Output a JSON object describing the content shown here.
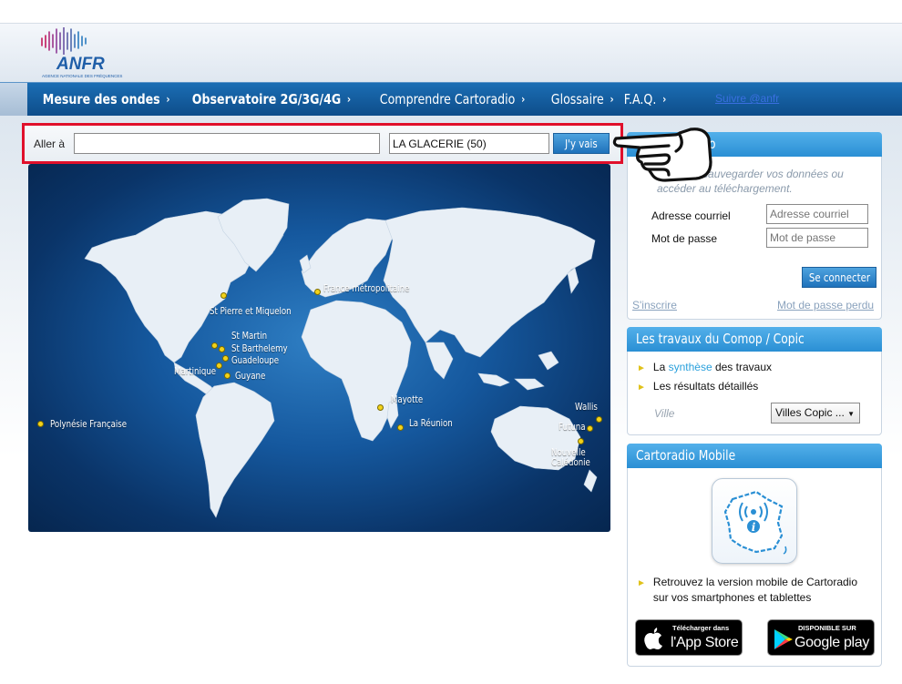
{
  "brand": {
    "logo_text": "ANFR",
    "logo_subtitle": "AGENCE NATIONALE DES FRÉQUENCES",
    "bar_colors": [
      "#c2185b",
      "#8e3c97",
      "#5b5ea6",
      "#2a7bbf"
    ]
  },
  "nav": {
    "items": [
      {
        "label": "Mesure des ondes",
        "bold": true
      },
      {
        "label": "Observatoire 2G/3G/4G",
        "bold": true
      },
      {
        "label": "Comprendre Cartoradio",
        "bold": false
      },
      {
        "label": "Glossaire",
        "bold": false
      },
      {
        "label": "F.A.Q.",
        "bold": false
      }
    ],
    "chevron": "›",
    "follow_link": "Suivre @anfr"
  },
  "search": {
    "label": "Aller à",
    "address_value": "",
    "commune_value": "LA GLACERIE (50)",
    "go_label": "J'y vais"
  },
  "map": {
    "labels": [
      {
        "text": "France métropolitaine"
      },
      {
        "text": "St Pierre et Miquelon"
      },
      {
        "text": "St Martin"
      },
      {
        "text": "St Barthelemy"
      },
      {
        "text": "Guadeloupe"
      },
      {
        "text": "Martinique"
      },
      {
        "text": "Guyane"
      },
      {
        "text": "Polynésie Française"
      },
      {
        "text": "Mayotte"
      },
      {
        "text": "La Réunion"
      },
      {
        "text": "Wallis"
      },
      {
        "text": "Futuna"
      },
      {
        "text": "Nouvelle"
      },
      {
        "text": "Calédonie"
      }
    ],
    "ocean_color": "#15589e",
    "land_color": "#e8eff6",
    "dot_color": "#f2d21a"
  },
  "login": {
    "title": "o",
    "intro": "ous pour sauvegarder vos données ou accéder au téléchargement.",
    "email_label": "Adresse courriel",
    "email_placeholder": "Adresse courriel",
    "password_label": "Mot de passe",
    "password_placeholder": "Mot de passe",
    "connect_label": "Se connecter",
    "register_link": "S'inscrire",
    "lost_password_link": "Mot de passe perdu"
  },
  "comop": {
    "title": "Les travaux du Comop / Copic",
    "line1_prefix": "La ",
    "line1_accent": "synthèse",
    "line1_suffix": " des travaux",
    "line2": "Les résultats détaillés",
    "ville_label": "Ville",
    "select_value": "Villes Copic ..."
  },
  "mobile": {
    "title": "Cartoradio Mobile",
    "text_line1": "Retrouvez la version mobile de Cartoradio",
    "text_line2": "sur vos smartphones et tablettes",
    "appstore_small": "Télécharger dans",
    "appstore_big": "l'App Store",
    "googleplay_small": "DISPONIBLE SUR",
    "googleplay_big": "Google play"
  },
  "colors": {
    "nav_blue": "#0e4d8a",
    "accent_blue": "#2a8fd4",
    "highlight_red": "#e0102b",
    "bullet_yellow": "#e0c21a"
  }
}
